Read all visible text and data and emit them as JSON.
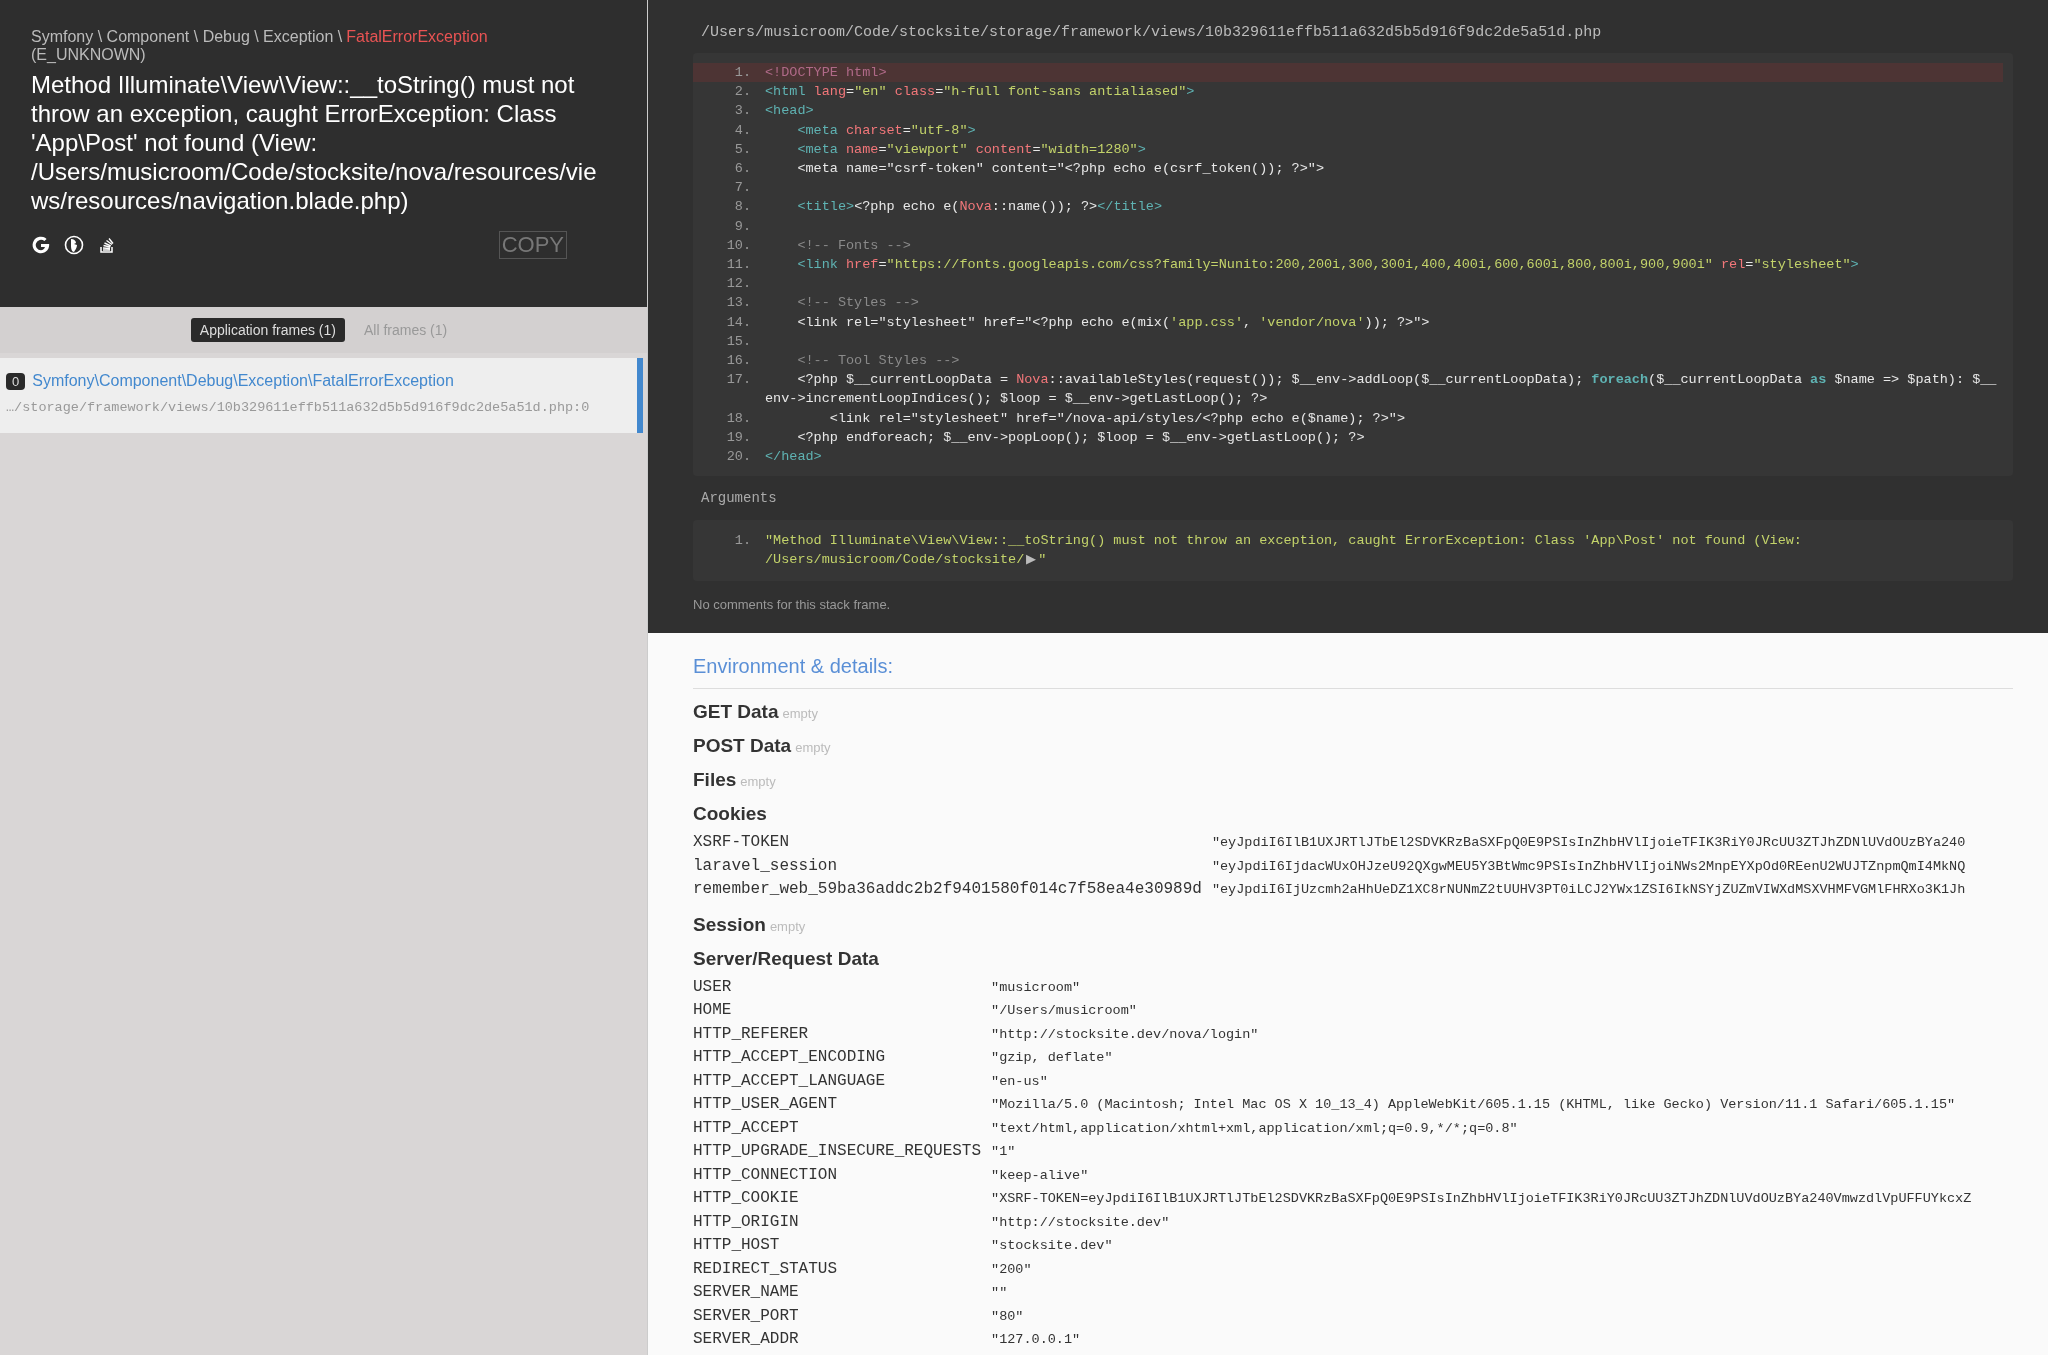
{
  "header": {
    "namespace": "Symfony \\ Component \\ Debug \\ Exception \\",
    "exception_class": "FatalErrorException",
    "code": "(E_UNKNOWN)",
    "message": "Method Illuminate\\View\\View::__toString() must not throw an exception, caught ErrorException: Class 'App\\Post' not found (View: /Users/musicroom/Code/stocksite/nova/resources/views/resources/navigation.blade.php)",
    "copy_button": "COPY"
  },
  "frame_tabs": [
    {
      "label": "Application frames (1)",
      "selected": true
    },
    {
      "label": "All frames (1)",
      "selected": false
    }
  ],
  "frames": [
    {
      "index": "0",
      "class": "Symfony\\Component\\Debug\\Exception\\FatalErrorException",
      "file": "…/storage/framework/views/10b329611effb511a632d5b5d916f9dc2de5a51d.php:0",
      "selected": true
    }
  ],
  "code": {
    "file_path": "/Users/musicroom/Code/stocksite/storage/framework/views/10b329611effb511a632d5b5d916f9dc2de5a51d.php",
    "lines": [
      {
        "number": "1.",
        "highlighted": true,
        "tokens": [
          {
            "kind": "doctype",
            "text": "<!DOCTYPE html>"
          }
        ]
      },
      {
        "number": "2.",
        "highlighted": false,
        "tokens": [
          {
            "kind": "tag",
            "text": "<html "
          },
          {
            "kind": "attr",
            "text": "lang"
          },
          {
            "kind": "plain",
            "text": "="
          },
          {
            "kind": "str",
            "text": "\"en\" "
          },
          {
            "kind": "attr",
            "text": "class"
          },
          {
            "kind": "plain",
            "text": "="
          },
          {
            "kind": "str",
            "text": "\"h-full font-sans antialiased\""
          },
          {
            "kind": "tag",
            "text": ">"
          }
        ]
      },
      {
        "number": "3.",
        "highlighted": false,
        "tokens": [
          {
            "kind": "tag",
            "text": "<head>"
          }
        ]
      },
      {
        "number": "4.",
        "highlighted": false,
        "tokens": [
          {
            "kind": "tag",
            "text": "    <meta "
          },
          {
            "kind": "attr",
            "text": "charset"
          },
          {
            "kind": "plain",
            "text": "="
          },
          {
            "kind": "str",
            "text": "\"utf-8\""
          },
          {
            "kind": "tag",
            "text": ">"
          }
        ]
      },
      {
        "number": "5.",
        "highlighted": false,
        "tokens": [
          {
            "kind": "tag",
            "text": "    <meta "
          },
          {
            "kind": "attr",
            "text": "name"
          },
          {
            "kind": "plain",
            "text": "="
          },
          {
            "kind": "str",
            "text": "\"viewport\" "
          },
          {
            "kind": "attr",
            "text": "content"
          },
          {
            "kind": "plain",
            "text": "="
          },
          {
            "kind": "str",
            "text": "\"width=1280\""
          },
          {
            "kind": "tag",
            "text": ">"
          }
        ]
      },
      {
        "number": "6.",
        "highlighted": false,
        "tokens": [
          {
            "kind": "plain",
            "text": "    <meta name=\"csrf-token\" content=\"<?php echo e(csrf_token()); ?>\">"
          }
        ]
      },
      {
        "number": "7.",
        "highlighted": false
      },
      {
        "number": "8.",
        "highlighted": false,
        "tokens": [
          {
            "kind": "tag",
            "text": "    <title>"
          },
          {
            "kind": "plain",
            "text": "<?php echo e("
          },
          {
            "kind": "cls",
            "text": "Nova"
          },
          {
            "kind": "plain",
            "text": "::name()); ?>"
          },
          {
            "kind": "tag",
            "text": "</title>"
          }
        ]
      },
      {
        "number": "9.",
        "highlighted": false
      },
      {
        "number": "10.",
        "highlighted": false,
        "tokens": [
          {
            "kind": "comment",
            "text": "    <!-- Fonts -->"
          }
        ]
      },
      {
        "number": "11.",
        "highlighted": false,
        "tokens": [
          {
            "kind": "tag",
            "text": "    <link "
          },
          {
            "kind": "attr",
            "text": "href"
          },
          {
            "kind": "plain",
            "text": "="
          },
          {
            "kind": "str",
            "text": "\"https://fonts.googleapis.com/css?family=Nunito:200,200i,300,300i,400,400i,600,600i,800,800i,900,900i\" "
          },
          {
            "kind": "attr",
            "text": "rel"
          },
          {
            "kind": "plain",
            "text": "="
          },
          {
            "kind": "str",
            "text": "\"stylesheet\""
          },
          {
            "kind": "tag",
            "text": ">"
          }
        ]
      },
      {
        "number": "12.",
        "highlighted": false
      },
      {
        "number": "13.",
        "highlighted": false,
        "tokens": [
          {
            "kind": "comment",
            "text": "    <!-- Styles -->"
          }
        ]
      },
      {
        "number": "14.",
        "highlighted": false,
        "tokens": [
          {
            "kind": "plain",
            "text": "    <link rel=\"stylesheet\" href=\"<?php echo e(mix("
          },
          {
            "kind": "str",
            "text": "'app.css'"
          },
          {
            "kind": "plain",
            "text": ", "
          },
          {
            "kind": "str",
            "text": "'vendor/nova'"
          },
          {
            "kind": "plain",
            "text": ")); ?>\">"
          }
        ]
      },
      {
        "number": "15.",
        "highlighted": false
      },
      {
        "number": "16.",
        "highlighted": false,
        "tokens": [
          {
            "kind": "comment",
            "text": "    <!-- Tool Styles -->"
          }
        ]
      },
      {
        "number": "17.",
        "highlighted": false,
        "tokens": [
          {
            "kind": "plain",
            "text": "    <?php $__currentLoopData = "
          },
          {
            "kind": "cls",
            "text": "Nova"
          },
          {
            "kind": "plain",
            "text": "::availableStyles(request()); $__env->addLoop($__currentLoopData); "
          },
          {
            "kind": "kw",
            "text": "foreach"
          },
          {
            "kind": "plain",
            "text": "($__currentLoopData "
          },
          {
            "kind": "kw",
            "text": "as"
          },
          {
            "kind": "plain",
            "text": " $name => $path): $__env->incrementLoopIndices(); $loop = $__env->getLastLoop(); ?>"
          }
        ]
      },
      {
        "number": "18.",
        "highlighted": false,
        "tokens": [
          {
            "kind": "plain",
            "text": "        <link rel=\"stylesheet\" href=\"/nova-api/styles/<?php echo e($name); ?>\">"
          }
        ]
      },
      {
        "number": "19.",
        "highlighted": false,
        "tokens": [
          {
            "kind": "plain",
            "text": "    <?php endforeach; $__env->popLoop(); $loop = $__env->getLastLoop(); ?>"
          }
        ]
      },
      {
        "number": "20.",
        "highlighted": false,
        "tokens": [
          {
            "kind": "tag",
            "text": "</head>"
          }
        ]
      }
    ]
  },
  "arguments": {
    "label": "Arguments",
    "items": [
      {
        "number": "1.",
        "value_lines": [
          "\"Method Illuminate\\View\\View::__toString() must not throw an exception, caught ErrorException: Class 'App\\Post' not found (View:",
          "/Users/musicroom/Code/stocksite/"
        ],
        "toggle": "▶",
        "value_end": "\""
      }
    ]
  },
  "comments": "No comments for this stack frame.",
  "environment": {
    "title": "Environment & details:",
    "sections": [
      {
        "kind": "empty",
        "title": "GET Data",
        "note": "empty"
      },
      {
        "kind": "empty",
        "title": "POST Data",
        "note": "empty"
      },
      {
        "kind": "empty",
        "title": "Files",
        "note": "empty"
      },
      {
        "kind": "table",
        "title": "Cookies",
        "rows": [
          {
            "key": "XSRF-TOKEN",
            "value": "\"eyJpdiI6IlB1UXJRTlJTbEl2SDVKRzBaSXFpQ0E9PSIsInZhbHVlIjoieTFIK3RiY0JRcUU3ZTJhZDNlUVdOUzBYa240"
          },
          {
            "key": "laravel_session",
            "value": "\"eyJpdiI6IjdacWUxOHJzeU92QXgwMEU5Y3BtWmc9PSIsInZhbHVlIjoiNWs2MnpEYXpOd0REenU2WUJTZnpmQmI4MkNQ"
          },
          {
            "key": "remember_web_59ba36addc2b2f9401580f014c7f58ea4e30989d",
            "value": "\"eyJpdiI6IjUzcmh2aHhUeDZ1XC8rNUNmZ2tUUHV3PT0iLCJ2YWx1ZSI6IkNSYjZUZmVIWXdMSXVHMFVGMlFHRXo3K1Jh"
          }
        ]
      },
      {
        "kind": "empty",
        "title": "Session",
        "note": "empty"
      },
      {
        "kind": "table",
        "title": "Server/Request Data",
        "rows": [
          {
            "key": "USER",
            "value": "\"musicroom\""
          },
          {
            "key": "HOME",
            "value": "\"/Users/musicroom\""
          },
          {
            "key": "HTTP_REFERER",
            "value": "\"http://stocksite.dev/nova/login\""
          },
          {
            "key": "HTTP_ACCEPT_ENCODING",
            "value": "\"gzip, deflate\""
          },
          {
            "key": "HTTP_ACCEPT_LANGUAGE",
            "value": "\"en-us\""
          },
          {
            "key": "HTTP_USER_AGENT",
            "value": "\"Mozilla/5.0 (Macintosh; Intel Mac OS X 10_13_4) AppleWebKit/605.1.15 (KHTML, like Gecko) Version/11.1 Safari/605.1.15\""
          },
          {
            "key": "HTTP_ACCEPT",
            "value": "\"text/html,application/xhtml+xml,application/xml;q=0.9,*/*;q=0.8\""
          },
          {
            "key": "HTTP_UPGRADE_INSECURE_REQUESTS",
            "value": "\"1\""
          },
          {
            "key": "HTTP_CONNECTION",
            "value": "\"keep-alive\""
          },
          {
            "key": "HTTP_COOKIE",
            "value": "\"XSRF-TOKEN=eyJpdiI6IlB1UXJRTlJTbEl2SDVKRzBaSXFpQ0E9PSIsInZhbHVlIjoieTFIK3RiY0JRcUU3ZTJhZDNlUVdOUzBYa240VmwzdlVpUFFUYkcxZ"
          },
          {
            "key": "HTTP_ORIGIN",
            "value": "\"http://stocksite.dev\""
          },
          {
            "key": "HTTP_HOST",
            "value": "\"stocksite.dev\""
          },
          {
            "key": "REDIRECT_STATUS",
            "value": "\"200\""
          },
          {
            "key": "SERVER_NAME",
            "value": "\"\""
          },
          {
            "key": "SERVER_PORT",
            "value": "\"80\""
          },
          {
            "key": "SERVER_ADDR",
            "value": "\"127.0.0.1\""
          }
        ]
      }
    ]
  }
}
